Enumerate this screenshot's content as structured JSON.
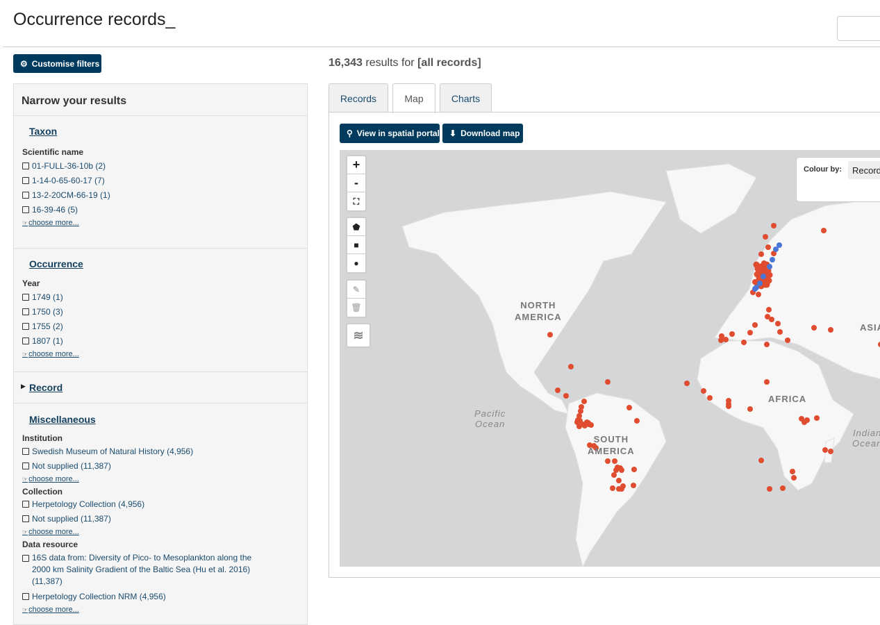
{
  "page": {
    "title": "Occurrence records",
    "cursor": "_"
  },
  "toolbar": {
    "customise_filters": "Customise filters"
  },
  "results": {
    "count": "16,343",
    "text": "results for",
    "query": "[all records]"
  },
  "panel": {
    "heading": "Narrow your results",
    "taxon": {
      "title": "Taxon",
      "label": "Scientific name",
      "items": [
        "01-FULL-36-10b (2)",
        "1-14-0-65-60-17 (7)",
        "13-2-20CM-66-19 (1)",
        "16-39-46 (5)"
      ],
      "choose": "choose more..."
    },
    "occurrence": {
      "title": "Occurrence",
      "label": "Year",
      "items": [
        "1749 (1)",
        "1750 (3)",
        "1755 (2)",
        "1807 (1)"
      ],
      "choose": "choose more..."
    },
    "record": {
      "title": "Record"
    },
    "misc": {
      "title": "Miscellaneous",
      "institution_label": "Institution",
      "institution_items": [
        "Swedish Museum of Natural History (4,956)",
        "Not supplied (11,387)"
      ],
      "collection_label": "Collection",
      "collection_items": [
        "Herpetology Collection (4,956)",
        "Not supplied (11,387)"
      ],
      "resource_label": "Data resource",
      "resource_items": [
        "16S data from: Diversity of Pico- to Mesoplankton along the 2000 km Salinity Gradient of the Baltic Sea (Hu et al. 2016) (11,387)",
        "Herpetology Collection NRM (4,956)"
      ],
      "choose": "choose more..."
    }
  },
  "tabs": [
    {
      "label": "Records"
    },
    {
      "label": "Map"
    },
    {
      "label": "Charts"
    }
  ],
  "map_toolbar": {
    "spatial": "View in spatial portal",
    "download": "Download map"
  },
  "map": {
    "zoom_in": "+",
    "zoom_out": "-",
    "colour_by_label": "Colour by:",
    "colour_by_value": "Record",
    "labels": {
      "north_america": [
        "NORTH",
        "AMERICA"
      ],
      "south_america": [
        "SOUTH",
        "AMERICA"
      ],
      "africa": "AFRICA",
      "asia": "ASIA",
      "pacific": [
        "Pacific",
        "Ocean"
      ],
      "indian": [
        "Indian",
        "Ocean"
      ]
    },
    "colors": {
      "record_point": "#e04c2f",
      "secondary_point": "#4a76d6",
      "land": "#f7f7f7",
      "water": "#d4d6d8"
    }
  }
}
